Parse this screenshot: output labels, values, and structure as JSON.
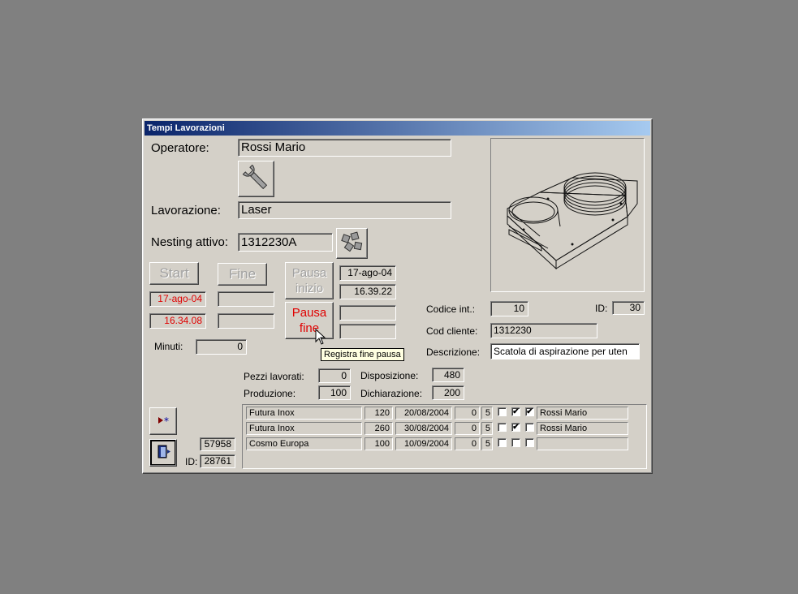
{
  "window": {
    "title": "Tempi Lavorazioni"
  },
  "form": {
    "operatore_label": "Operatore:",
    "operatore_value": "Rossi Mario",
    "lavorazione_label": "Lavorazione:",
    "lavorazione_value": "Laser",
    "nesting_label": "Nesting attivo:",
    "nesting_value": "1312230A",
    "start_label": "Start",
    "fine_label": "Fine",
    "start_date": "17-ago-04",
    "start_time": "16.34.08",
    "fine_date": "",
    "fine_time": "",
    "pausa_inizio_label": "Pausa inizio",
    "pausa_inizio_date": "17-ago-04",
    "pausa_inizio_time": "16.39.22",
    "pausa_fine_label": "Pausa fine",
    "pausa_fine_date": "",
    "pausa_fine_time": "",
    "minuti_label": "Minuti:",
    "minuti_value": "0",
    "tooltip": "Registra fine pausa"
  },
  "detail": {
    "codice_int_label": "Codice  int.:",
    "codice_int_value": "10",
    "id_label": "ID:",
    "id_value": "30",
    "cod_cliente_label": "Cod cliente:",
    "cod_cliente_value": "1312230",
    "descrizione_label": "Descrizione:",
    "descrizione_value": "Scatola di aspirazione per uten"
  },
  "stats": {
    "pezzi_label": "Pezzi lavorati:",
    "pezzi_value": "0",
    "produzione_label": "Produzione:",
    "produzione_value": "100",
    "disposizione_label": "Disposizione:",
    "disposizione_value": "480",
    "dichiarazione_label": "Dichiarazione:",
    "dichiarazione_value": "200"
  },
  "footer": {
    "record_value": "57958",
    "id_label": "ID:",
    "id_value": "28761"
  },
  "rows": [
    {
      "cliente": "Futura Inox",
      "qta": "120",
      "data": "20/08/2004",
      "n1": "0",
      "n2": "5",
      "c1": false,
      "c2": true,
      "c3": true,
      "operatore": "Rossi Mario"
    },
    {
      "cliente": "Futura Inox",
      "qta": "260",
      "data": "30/08/2004",
      "n1": "0",
      "n2": "5",
      "c1": false,
      "c2": true,
      "c3": false,
      "operatore": "Rossi Mario"
    },
    {
      "cliente": "Cosmo Europa",
      "qta": "100",
      "data": "10/09/2004",
      "n1": "0",
      "n2": "5",
      "c1": false,
      "c2": false,
      "c3": false,
      "operatore": ""
    }
  ],
  "icons": {
    "tool": "wrench-icon",
    "nesting": "parts-icon",
    "new_record": "new-record-icon",
    "exit": "exit-door-icon",
    "cursor": "mouse-pointer-icon"
  }
}
